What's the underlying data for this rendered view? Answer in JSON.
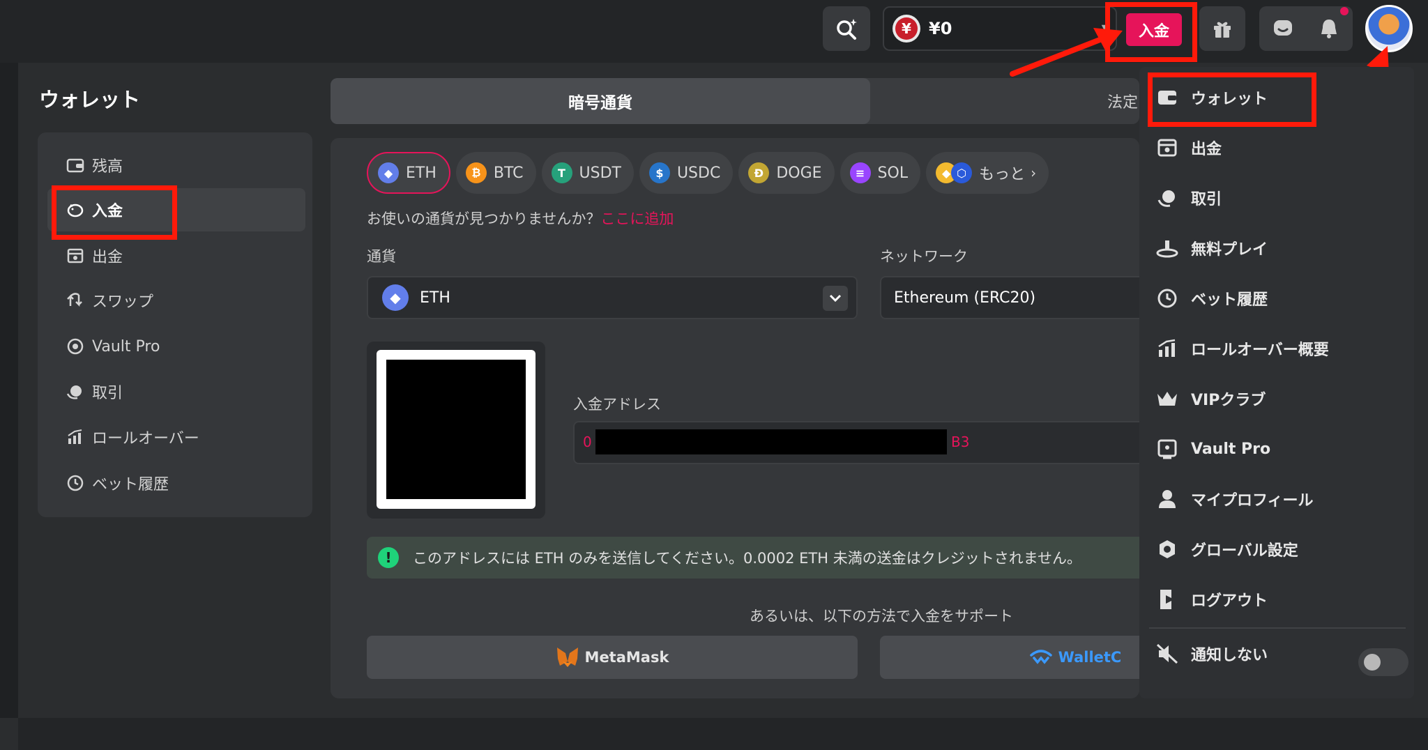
{
  "header": {
    "balance": "¥0",
    "currency_symbol": "¥",
    "deposit_label": "入金"
  },
  "sidebar": {
    "title": "ウォレット",
    "items": [
      {
        "label": "残高",
        "icon": "wallet-icon"
      },
      {
        "label": "入金",
        "icon": "piggy-bank-icon"
      },
      {
        "label": "出金",
        "icon": "cash-register-icon"
      },
      {
        "label": "スワップ",
        "icon": "swap-icon"
      },
      {
        "label": "Vault Pro",
        "icon": "vault-icon"
      },
      {
        "label": "取引",
        "icon": "trade-icon"
      },
      {
        "label": "ロールオーバー",
        "icon": "bar-chart-icon"
      },
      {
        "label": "ベット履歴",
        "icon": "clock-icon"
      }
    ]
  },
  "tabs": {
    "crypto": "暗号通貨",
    "fiat": "法定"
  },
  "chips": [
    {
      "label": "ETH",
      "color": "#627eea",
      "glyph": "◆"
    },
    {
      "label": "BTC",
      "color": "#f7931a",
      "glyph": "₿"
    },
    {
      "label": "USDT",
      "color": "#26a17b",
      "glyph": "T"
    },
    {
      "label": "USDC",
      "color": "#2775ca",
      "glyph": "$"
    },
    {
      "label": "DOGE",
      "color": "#c2a633",
      "glyph": "Ð"
    },
    {
      "label": "SOL",
      "color": "#9945ff",
      "glyph": "≡"
    },
    {
      "label": "もっと",
      "color": "#f3ba2f",
      "glyph": "◆"
    }
  ],
  "hint": {
    "text": "お使いの通貨が見つかりませんか？",
    "link": "ここに追加"
  },
  "currency": {
    "label": "通貨",
    "value": "ETH"
  },
  "network": {
    "label": "ネットワーク",
    "value": "Ethereum (ERC20)"
  },
  "address": {
    "label": "入金アドレス",
    "prefix": "0",
    "suffix": "B3"
  },
  "warning": "このアドレスには ETH のみを送信してください。0.0002 ETH 未満の送金はクレジットされません。",
  "support_text": "あるいは、以下の方法で入金をサポート",
  "payments": {
    "metamask": "MetaMask",
    "walletconnect": "WalletC"
  },
  "menu": {
    "items": [
      {
        "label": "ウォレット",
        "icon": "wallet-icon"
      },
      {
        "label": "出金",
        "icon": "cash-register-icon"
      },
      {
        "label": "取引",
        "icon": "trade-icon"
      },
      {
        "label": "無料プレイ",
        "icon": "free-play-icon"
      },
      {
        "label": "ベット履歴",
        "icon": "clock-icon"
      },
      {
        "label": "ロールオーバー概要",
        "icon": "bar-chart-icon"
      },
      {
        "label": "VIPクラブ",
        "icon": "crown-icon"
      },
      {
        "label": "Vault Pro",
        "icon": "vault-icon"
      },
      {
        "label": "マイプロフィール",
        "icon": "user-icon"
      },
      {
        "label": "グローバル設定",
        "icon": "gear-icon"
      },
      {
        "label": "ログアウト",
        "icon": "logout-icon"
      }
    ],
    "mute_label": "通知しない"
  },
  "colors": {
    "accent": "#e6145a",
    "annotation": "#ff1a0a",
    "success": "#1fd27a"
  }
}
